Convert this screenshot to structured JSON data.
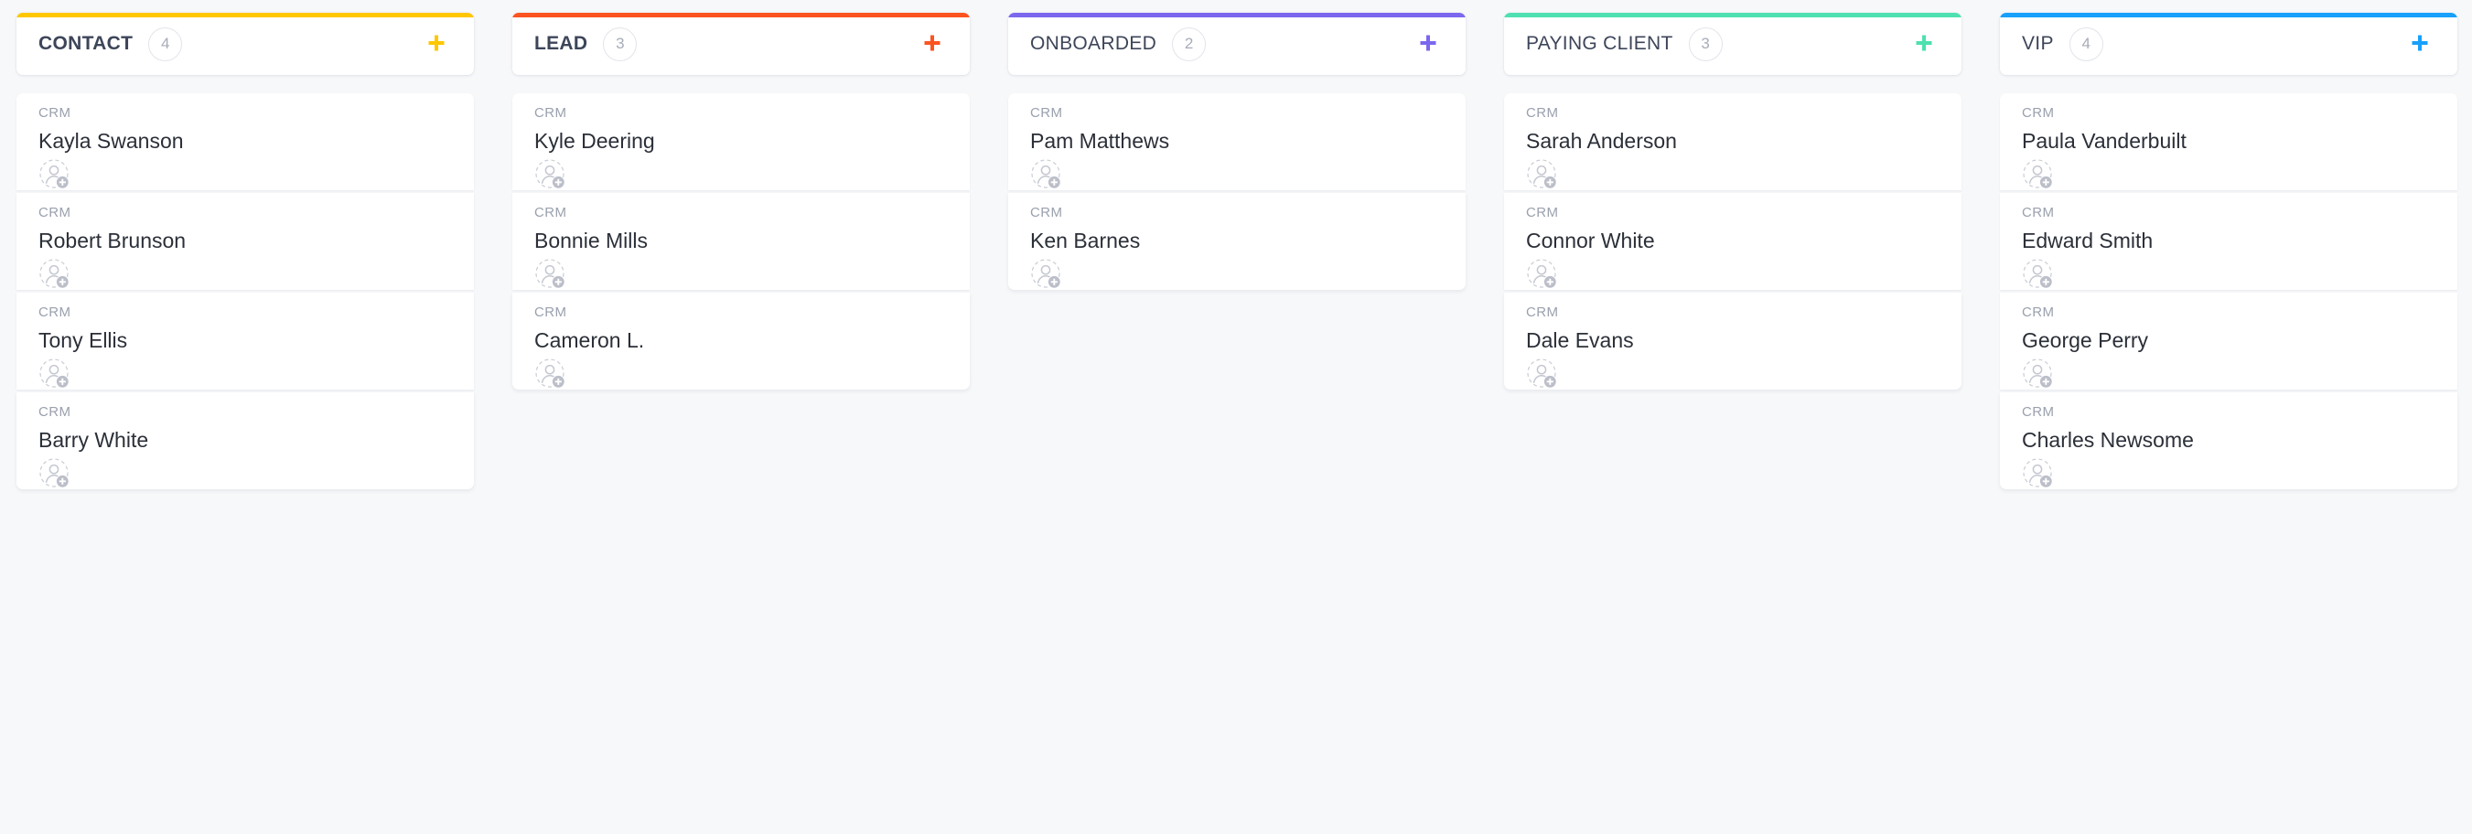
{
  "board": {
    "background_color": "#f7f8fa",
    "card_tag_default": "CRM",
    "add_icon_name": "plus-icon",
    "avatar_icon_name": "add-assignee-avatar-icon"
  },
  "columns": [
    {
      "title": "CONTACT",
      "count": "4",
      "accent_color": "#ffc700",
      "title_weight": "bold",
      "add_label": "+",
      "cards": [
        {
          "tag": "CRM",
          "name": "Kayla Swanson"
        },
        {
          "tag": "CRM",
          "name": "Robert Brunson"
        },
        {
          "tag": "CRM",
          "name": "Tony Ellis"
        },
        {
          "tag": "CRM",
          "name": "Barry White"
        }
      ]
    },
    {
      "title": "LEAD",
      "count": "3",
      "accent_color": "#fb5421",
      "title_weight": "bold",
      "add_label": "+",
      "cards": [
        {
          "tag": "CRM",
          "name": "Kyle Deering"
        },
        {
          "tag": "CRM",
          "name": "Bonnie Mills"
        },
        {
          "tag": "CRM",
          "name": "Cameron L."
        }
      ]
    },
    {
      "title": "ONBOARDED",
      "count": "2",
      "accent_color": "#7b68ee",
      "title_weight": "normal",
      "add_label": "+",
      "cards": [
        {
          "tag": "CRM",
          "name": "Pam Matthews"
        },
        {
          "tag": "CRM",
          "name": "Ken Barnes"
        }
      ]
    },
    {
      "title": "PAYING CLIENT",
      "count": "3",
      "accent_color": "#4ee0b0",
      "title_weight": "normal",
      "add_label": "+",
      "cards": [
        {
          "tag": "CRM",
          "name": "Sarah Anderson"
        },
        {
          "tag": "CRM",
          "name": "Connor White"
        },
        {
          "tag": "CRM",
          "name": "Dale Evans"
        }
      ]
    },
    {
      "title": "VIP",
      "count": "4",
      "accent_color": "#18a0fb",
      "title_weight": "normal",
      "add_label": "+",
      "cards": [
        {
          "tag": "CRM",
          "name": "Paula Vanderbuilt"
        },
        {
          "tag": "CRM",
          "name": "Edward Smith"
        },
        {
          "tag": "CRM",
          "name": "George Perry"
        },
        {
          "tag": "CRM",
          "name": "Charles Newsome"
        }
      ]
    }
  ]
}
